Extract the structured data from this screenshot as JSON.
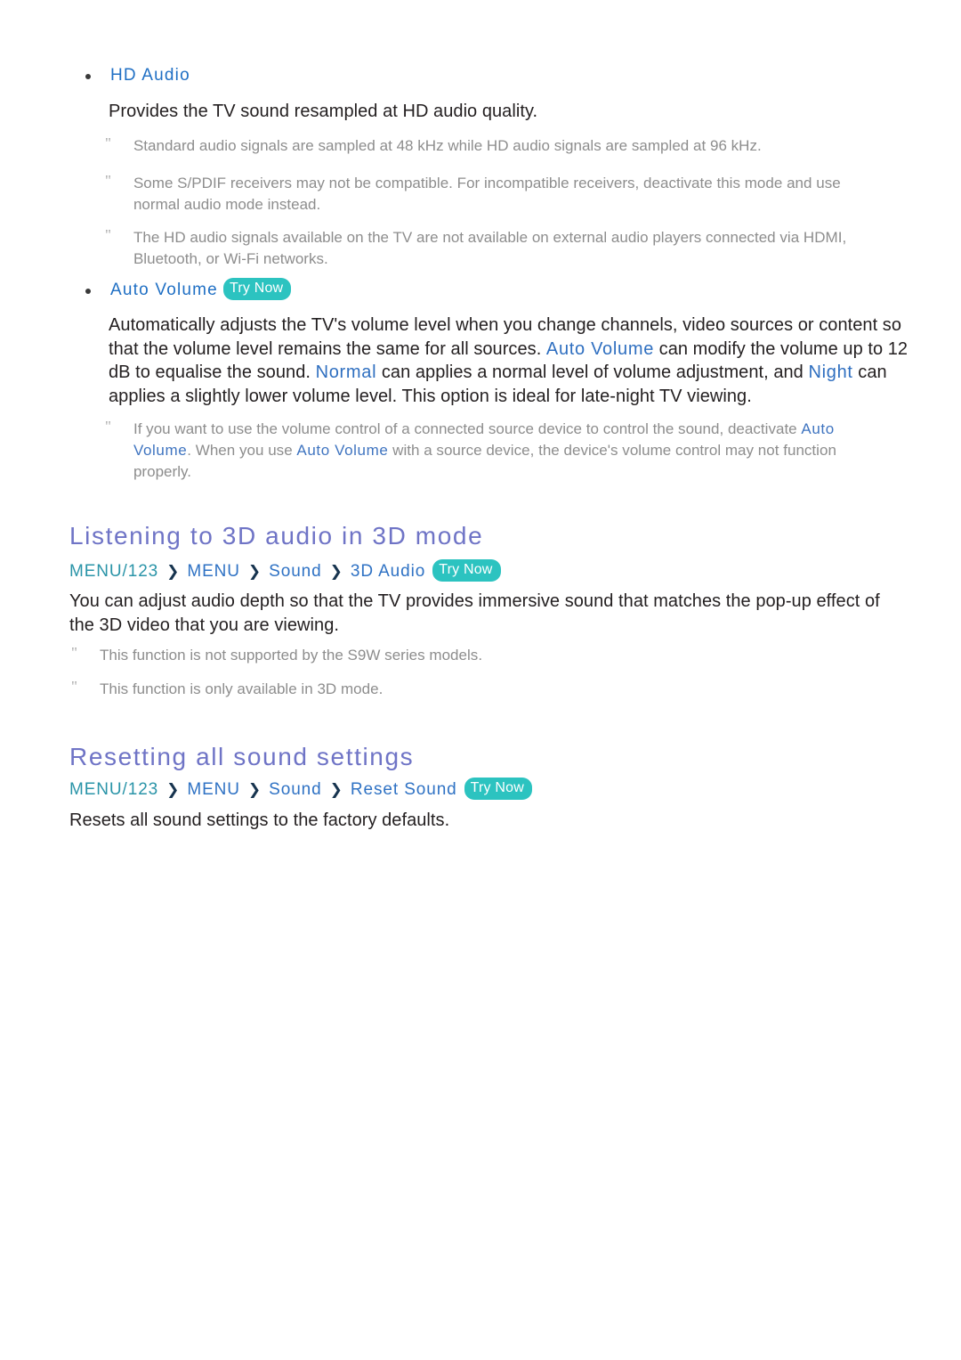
{
  "badges": {
    "try_now": "Try Now"
  },
  "colors": {
    "term_blue": "#2f6fc0",
    "bullet_blue": "#1f6fc4",
    "heading_violet": "#6f74c6",
    "breadcrumb_teal": "#2a94a8",
    "breadcrumb_blue": "#2f72c4",
    "note_gray": "#8d8d8d",
    "badge_teal": "#2cc3c0",
    "body_text": "#231f20"
  },
  "hd_audio": {
    "bullet_label": "HD Audio",
    "description": "Provides the TV sound resampled at HD audio quality.",
    "notes": [
      "Standard audio signals are sampled at 48 kHz while HD audio signals are sampled at 96 kHz.",
      "Some S/PDIF receivers may not be compatible. For incompatible receivers, deactivate this mode and use normal audio mode instead.",
      "The HD audio signals available on the TV are not available on external audio players connected via HDMI, Bluetooth, or Wi-Fi networks."
    ]
  },
  "auto_volume": {
    "bullet_label": "Auto Volume",
    "paragraph": {
      "part1": "Automatically adjusts the TV's volume level when you change channels, video sources or content so that the volume level remains the same for all sources. ",
      "term1": "Auto Volume",
      "part2": " can modify the volume up to 12 dB to equalise the sound. ",
      "term2": "Normal",
      "part3": " can applies a normal level of volume adjustment, and ",
      "term3": "Night",
      "part4": " can applies a slightly lower volume level. This option is ideal for late-night TV viewing."
    },
    "note": {
      "part1": "If you want to use the volume control of a connected source device to control the sound, deactivate ",
      "term1": "Auto Volume",
      "part2": ". When you use ",
      "term2": "Auto Volume",
      "part3": " with a source device, the device's volume control may not function properly."
    }
  },
  "section_3d_audio": {
    "title": "Listening to 3D audio in 3D mode",
    "breadcrumb": [
      "MENU/123",
      "MENU",
      "Sound",
      "3D Audio"
    ],
    "separator": "❯",
    "paragraph": "You can adjust audio depth so that the TV provides immersive sound that matches the pop-up effect of the 3D video that you are viewing.",
    "notes": [
      "This function is not supported by the S9W series models.",
      "This function is only available in 3D mode."
    ]
  },
  "section_reset_sound": {
    "title": "Resetting all sound settings",
    "breadcrumb": [
      "MENU/123",
      "MENU",
      "Sound",
      "Reset Sound"
    ],
    "separator": "❯",
    "paragraph": "Resets all sound settings to the factory defaults."
  }
}
